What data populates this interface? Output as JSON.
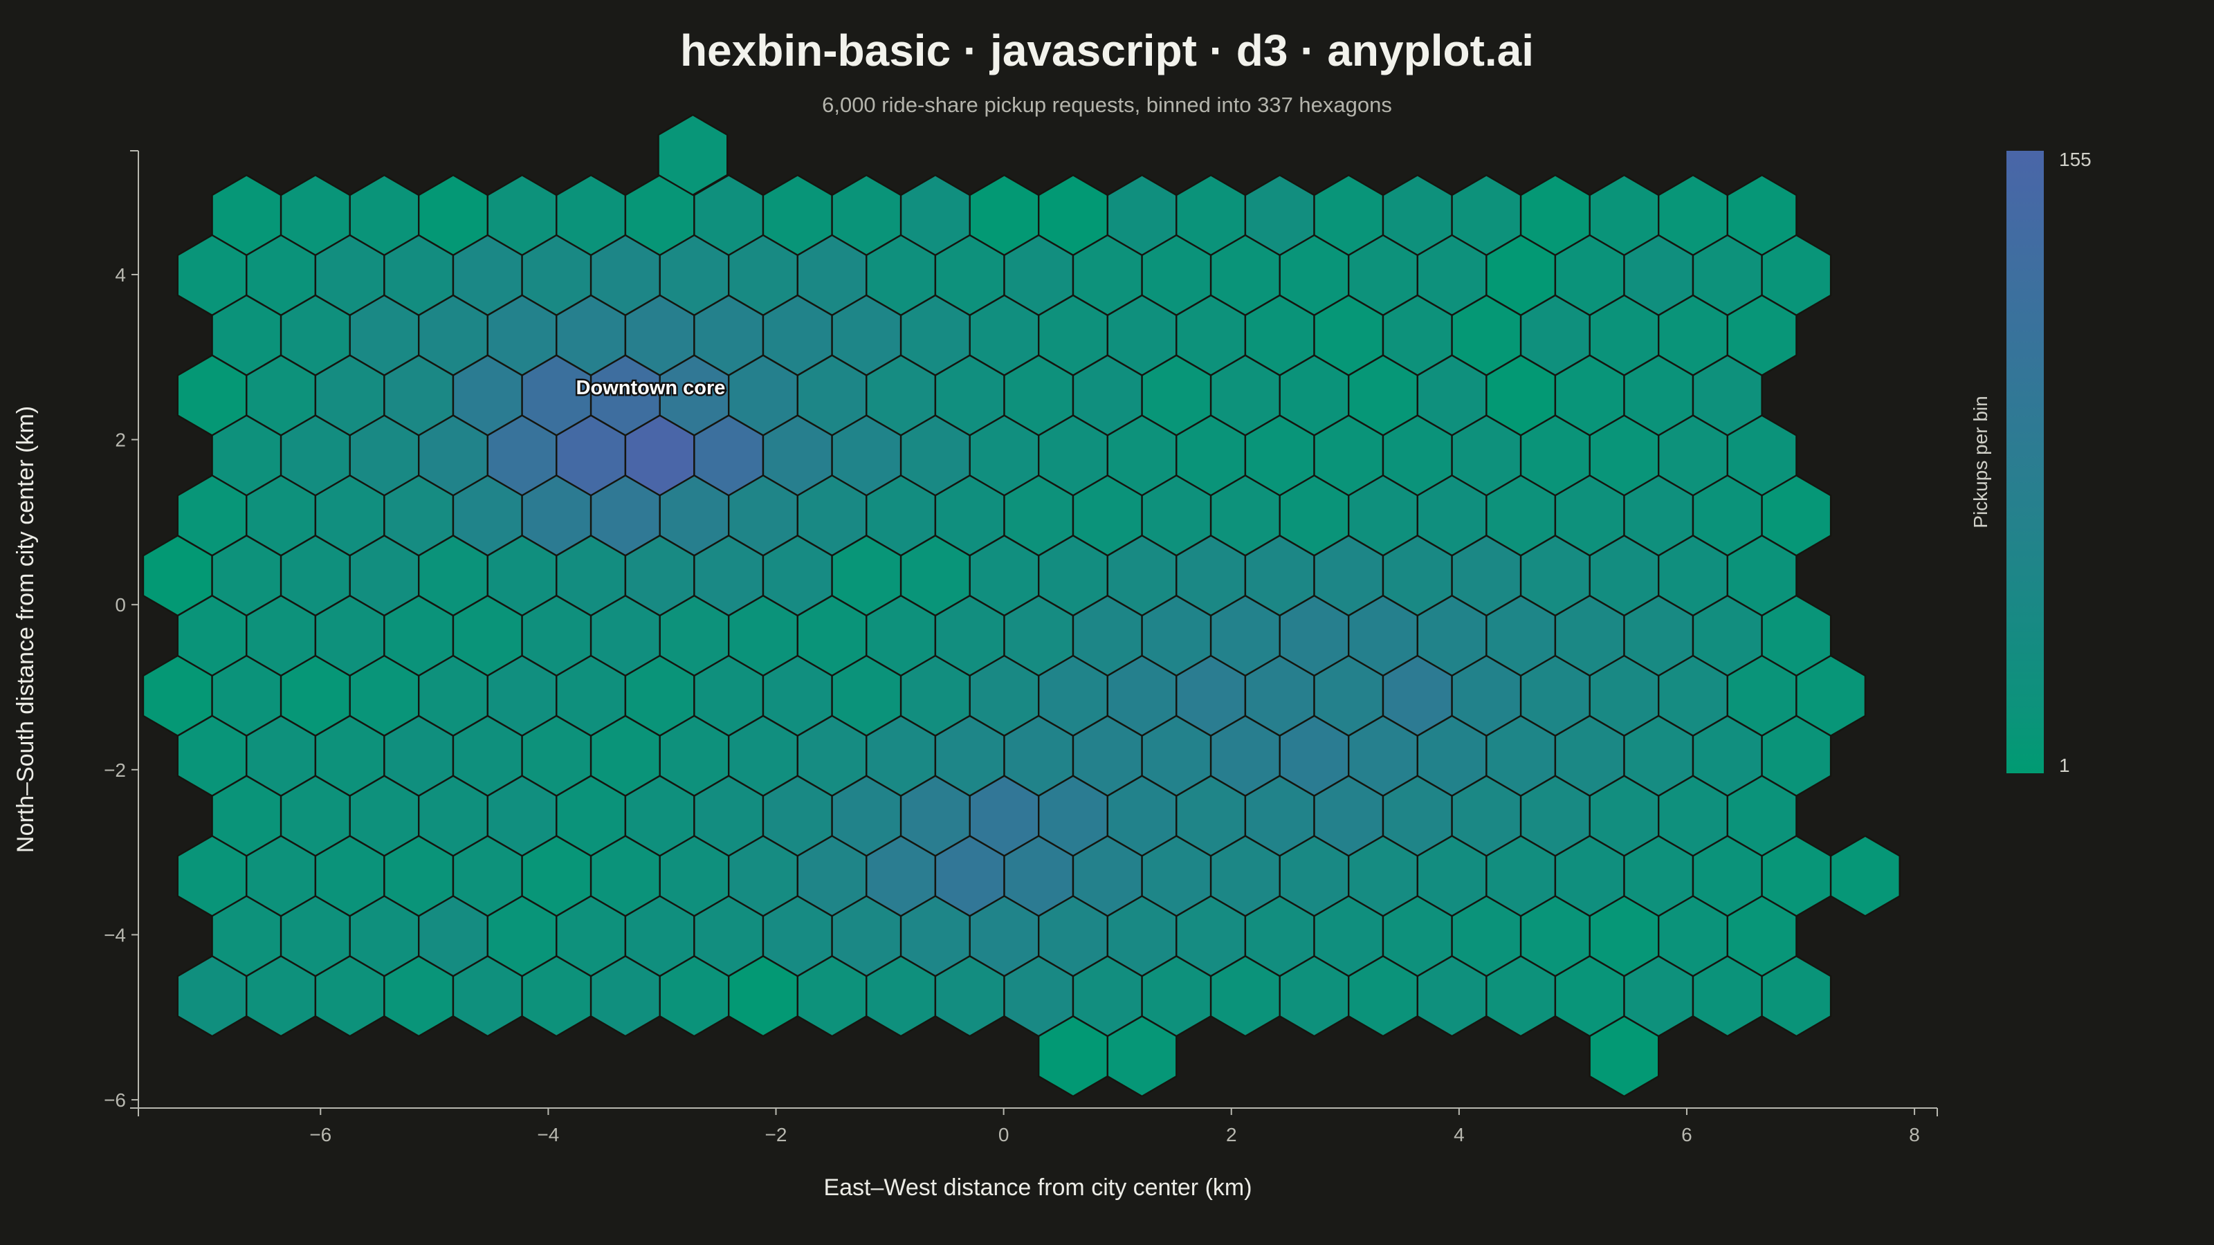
{
  "chart_data": {
    "type": "hexbin",
    "title": "hexbin-basic · javascript · d3 · anyplot.ai",
    "subtitle": "6,000 ride-share pickup requests, binned into 337 hexagons",
    "xlabel": "East–West distance from city center (km)",
    "ylabel": "North–South distance from city center (km)",
    "xlim": [
      -7.6,
      8.2
    ],
    "ylim": [
      -6.1,
      5.5
    ],
    "x_ticks": [
      -6,
      -4,
      -2,
      0,
      2,
      4,
      6,
      8
    ],
    "y_ticks": [
      -6,
      -4,
      -2,
      0,
      2,
      4
    ],
    "colorbar": {
      "label": "Pickups per bin",
      "min": 1,
      "max": 155
    },
    "color_low": "#009b72",
    "color_high": "#4a66a8",
    "annotations": [
      {
        "text": "Downtown core",
        "x": -3.1,
        "y": 2.55
      }
    ],
    "hex_grid": {
      "dx": 0.605,
      "dy": 0.728,
      "x0": -6.65,
      "y0": 4.72
    },
    "hex_rows": [
      {
        "offset": 0,
        "cols": [
          0,
          1,
          2,
          3,
          4,
          5,
          6,
          7,
          8,
          9,
          10,
          11,
          12,
          13,
          14,
          15,
          16,
          17,
          18,
          19,
          20,
          21,
          22
        ],
        "counts": [
          8,
          12,
          14,
          5,
          18,
          16,
          9,
          22,
          11,
          14,
          26,
          4,
          3,
          24,
          16,
          28,
          12,
          20,
          18,
          6,
          14,
          10,
          8
        ]
      },
      {
        "offset": 1,
        "cols": [
          0,
          1,
          2,
          3,
          4,
          5,
          6,
          7,
          8,
          9,
          10,
          11,
          12,
          13,
          14,
          15,
          16,
          17,
          18,
          19,
          20,
          21,
          22,
          23
        ],
        "counts": [
          12,
          16,
          28,
          30,
          45,
          40,
          48,
          42,
          38,
          44,
          22,
          20,
          28,
          18,
          16,
          14,
          12,
          18,
          20,
          4,
          16,
          24,
          18,
          12
        ]
      },
      {
        "offset": 0,
        "cols": [
          0,
          1,
          2,
          3,
          4,
          5,
          6,
          7,
          8,
          9,
          10,
          11,
          12,
          13,
          14,
          15,
          16,
          17,
          18,
          19,
          20,
          21,
          22
        ],
        "counts": [
          16,
          22,
          42,
          48,
          62,
          68,
          70,
          64,
          58,
          50,
          36,
          26,
          20,
          22,
          18,
          14,
          8,
          18,
          6,
          22,
          16,
          14,
          10
        ]
      },
      {
        "offset": 1,
        "cols": [
          0,
          1,
          2,
          3,
          4,
          5,
          6,
          7,
          8,
          9,
          10,
          11,
          12,
          13,
          14,
          15,
          16,
          17,
          18,
          19,
          20,
          21,
          22
        ],
        "counts": [
          6,
          18,
          32,
          44,
          80,
          118,
          125,
          92,
          66,
          48,
          34,
          26,
          20,
          24,
          10,
          18,
          16,
          8,
          22,
          4,
          12,
          16,
          20
        ]
      },
      {
        "offset": 0,
        "cols": [
          0,
          1,
          2,
          3,
          4,
          5,
          6,
          7,
          8,
          9,
          10,
          11,
          12,
          13,
          14,
          15,
          16,
          17,
          18,
          19,
          20,
          21,
          22
        ],
        "counts": [
          20,
          30,
          40,
          58,
          110,
          140,
          155,
          120,
          70,
          56,
          40,
          26,
          22,
          18,
          14,
          12,
          14,
          16,
          20,
          14,
          12,
          18,
          16
        ]
      },
      {
        "offset": 1,
        "cols": [
          0,
          1,
          2,
          3,
          4,
          5,
          6,
          7,
          8,
          9,
          10,
          11,
          12,
          13,
          14,
          15,
          16,
          17,
          18,
          19,
          20,
          21,
          22,
          23
        ],
        "counts": [
          10,
          20,
          26,
          34,
          56,
          82,
          90,
          70,
          52,
          40,
          30,
          24,
          18,
          16,
          20,
          18,
          14,
          22,
          24,
          18,
          20,
          22,
          16,
          8
        ]
      },
      {
        "offset": 0,
        "cols": [
          -1,
          0,
          1,
          2,
          3,
          4,
          5,
          6,
          7,
          8,
          9,
          10,
          11,
          12,
          13,
          14,
          15,
          16,
          17,
          18,
          19,
          20,
          21,
          22
        ],
        "counts": [
          4,
          18,
          22,
          28,
          16,
          24,
          30,
          38,
          42,
          36,
          10,
          12,
          26,
          30,
          38,
          44,
          46,
          48,
          40,
          44,
          34,
          30,
          24,
          16
        ]
      },
      {
        "offset": 1,
        "cols": [
          0,
          1,
          2,
          3,
          4,
          5,
          6,
          7,
          8,
          9,
          10,
          11,
          12,
          13,
          14,
          15,
          16,
          17,
          18,
          19,
          20,
          21,
          22,
          23
        ],
        "counts": [
          14,
          18,
          20,
          16,
          14,
          22,
          26,
          18,
          16,
          14,
          20,
          28,
          34,
          48,
          56,
          62,
          70,
          66,
          58,
          50,
          44,
          38,
          28,
          12
        ]
      },
      {
        "offset": 0,
        "cols": [
          -1,
          0,
          1,
          2,
          3,
          4,
          5,
          6,
          7,
          8,
          9,
          10,
          11,
          12,
          13,
          14,
          15,
          16,
          17,
          18,
          19,
          20,
          21,
          22,
          23
        ],
        "counts": [
          6,
          16,
          8,
          12,
          20,
          26,
          22,
          14,
          22,
          26,
          16,
          28,
          40,
          56,
          66,
          78,
          70,
          64,
          84,
          60,
          48,
          40,
          34,
          14,
          10
        ]
      },
      {
        "offset": 1,
        "cols": [
          0,
          1,
          2,
          3,
          4,
          5,
          6,
          7,
          8,
          9,
          10,
          11,
          12,
          13,
          14,
          15,
          16,
          17,
          18,
          19,
          20,
          21,
          22,
          23
        ],
        "counts": [
          12,
          20,
          18,
          24,
          22,
          18,
          14,
          20,
          26,
          34,
          42,
          50,
          58,
          64,
          62,
          72,
          80,
          68,
          60,
          50,
          44,
          34,
          26,
          14
        ]
      },
      {
        "offset": 0,
        "cols": [
          0,
          1,
          2,
          3,
          4,
          5,
          6,
          7,
          8,
          9,
          10,
          11,
          12,
          13,
          14,
          15,
          16,
          17,
          18,
          19,
          20,
          21,
          22
        ],
        "counts": [
          14,
          18,
          20,
          22,
          26,
          16,
          22,
          30,
          40,
          58,
          76,
          96,
          80,
          60,
          52,
          58,
          64,
          52,
          44,
          38,
          28,
          22,
          16
        ]
      },
      {
        "offset": 1,
        "cols": [
          0,
          1,
          2,
          3,
          4,
          5,
          6,
          7,
          8,
          9,
          10,
          11,
          12,
          13,
          14,
          15,
          16,
          17,
          18,
          19,
          20,
          21,
          22,
          23,
          24
        ],
        "counts": [
          12,
          18,
          16,
          14,
          18,
          10,
          16,
          22,
          34,
          52,
          78,
          96,
          82,
          64,
          50,
          46,
          40,
          34,
          30,
          28,
          24,
          20,
          16,
          10,
          8
        ]
      },
      {
        "offset": 0,
        "cols": [
          0,
          1,
          2,
          3,
          4,
          5,
          6,
          7,
          8,
          9,
          10,
          11,
          12,
          13,
          14,
          15,
          16,
          17,
          18,
          19,
          20,
          21,
          22
        ],
        "counts": [
          18,
          20,
          22,
          32,
          12,
          20,
          24,
          28,
          36,
          44,
          50,
          56,
          48,
          40,
          34,
          28,
          24,
          20,
          16,
          12,
          8,
          16,
          10
        ]
      },
      {
        "offset": 1,
        "cols": [
          0,
          1,
          2,
          3,
          4,
          5,
          6,
          7,
          8,
          9,
          10,
          11,
          12,
          13,
          14,
          15,
          16,
          17,
          18,
          19,
          20,
          21,
          22,
          23
        ],
        "counts": [
          24,
          20,
          18,
          12,
          22,
          18,
          24,
          16,
          4,
          18,
          22,
          30,
          40,
          28,
          20,
          16,
          20,
          16,
          22,
          18,
          12,
          20,
          16,
          14
        ]
      },
      {
        "offset": 0,
        "cols": [
          12,
          13,
          20
        ],
        "counts": [
          3,
          8,
          4
        ]
      }
    ],
    "extra_hexes": [
      {
        "x": -2.73,
        "y": 5.45,
        "count": 10
      }
    ]
  }
}
